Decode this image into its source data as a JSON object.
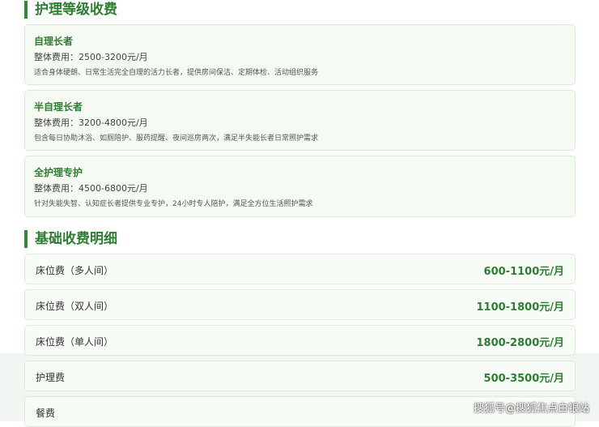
{
  "care_section": {
    "title": "护理等级收费",
    "levels": [
      {
        "name": "自理长者",
        "price": "整体费用：2500-3200元/月",
        "desc": "适合身体硬朗、日常生活完全自理的活力长者，提供房间保洁、定期体检、活动组织服务"
      },
      {
        "name": "半自理长者",
        "price": "整体费用：3200-4800元/月",
        "desc": "包含每日协助沐浴、如厕陪护、服药提醒、夜间巡房两次，满足半失能长者日常照护需求"
      },
      {
        "name": "全护理专护",
        "price": "整体费用：4500-6800元/月",
        "desc": "针对失能失智、认知症长者提供专业专护，24小时专人陪护，满足全方位生活照护需求"
      }
    ]
  },
  "basic_section": {
    "title": "基础收费明细",
    "rows": [
      {
        "name": "床位费（多人间）",
        "value": "600-1100元/月"
      },
      {
        "name": "床位费（双人间）",
        "value": "1100-1800元/月"
      },
      {
        "name": "床位费（单人间）",
        "value": "1800-2800元/月"
      },
      {
        "name": "护理费",
        "value": "500-3500元/月"
      },
      {
        "name": "餐费",
        "value": ""
      }
    ]
  },
  "watermark": "搜狐号@搜狐焦点白银站",
  "colors": {
    "accent": "#2e7d32",
    "card_bg": "#f5fbf3",
    "border": "#dbecd6"
  }
}
